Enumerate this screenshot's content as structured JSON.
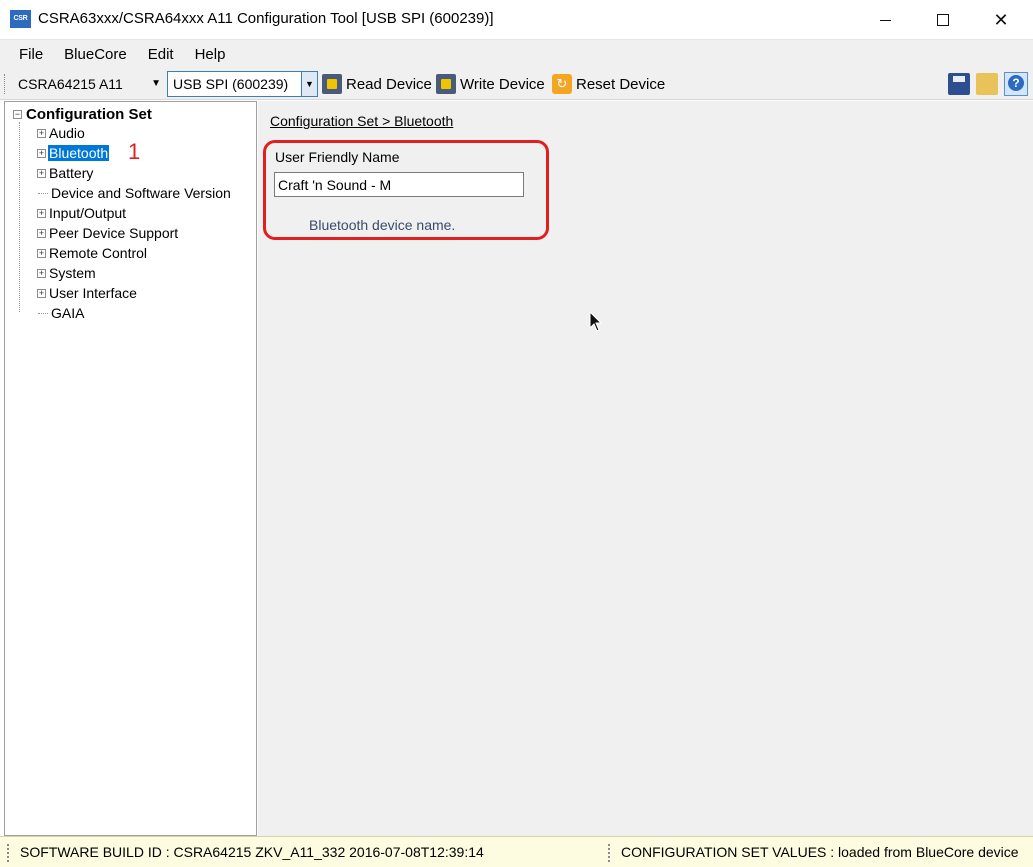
{
  "window": {
    "title": "CSRA63xxx/CSRA64xxx A11 Configuration Tool [USB SPI (600239)]",
    "app_icon_text": "CSR"
  },
  "menu": {
    "items": [
      {
        "label": "File"
      },
      {
        "label": "BlueCore"
      },
      {
        "label": "Edit"
      },
      {
        "label": "Help"
      }
    ]
  },
  "toolbar": {
    "chip_select": "CSRA64215 A11",
    "port_select": "USB SPI (600239)",
    "read_label": "Read Device",
    "write_label": "Write Device",
    "reset_label": "Reset Device"
  },
  "tree": {
    "root_label": "Configuration Set",
    "items": [
      {
        "label": "Audio",
        "expandable": true
      },
      {
        "label": "Bluetooth",
        "expandable": true,
        "selected": true
      },
      {
        "label": "Battery",
        "expandable": true
      },
      {
        "label": "Device and Software Version",
        "expandable": false
      },
      {
        "label": "Input/Output",
        "expandable": true
      },
      {
        "label": "Peer Device Support",
        "expandable": true
      },
      {
        "label": "Remote Control",
        "expandable": true
      },
      {
        "label": "System",
        "expandable": true
      },
      {
        "label": "User Interface",
        "expandable": true
      },
      {
        "label": "GAIA",
        "expandable": false
      }
    ],
    "annotation": "1"
  },
  "content": {
    "breadcrumb": "Configuration Set > Bluetooth",
    "field_label": "User Friendly Name",
    "field_value": "Craft 'n Sound - M",
    "field_description": "Bluetooth device name."
  },
  "status": {
    "left": "SOFTWARE BUILD ID :  CSRA64215 ZKV_A11_332 2016-07-08T12:39:14",
    "right": "CONFIGURATION SET VALUES :  loaded from BlueCore device"
  },
  "colors": {
    "selection": "#0078d7",
    "annotation_red": "#e0201e",
    "status_background": "#fdfbe0"
  }
}
